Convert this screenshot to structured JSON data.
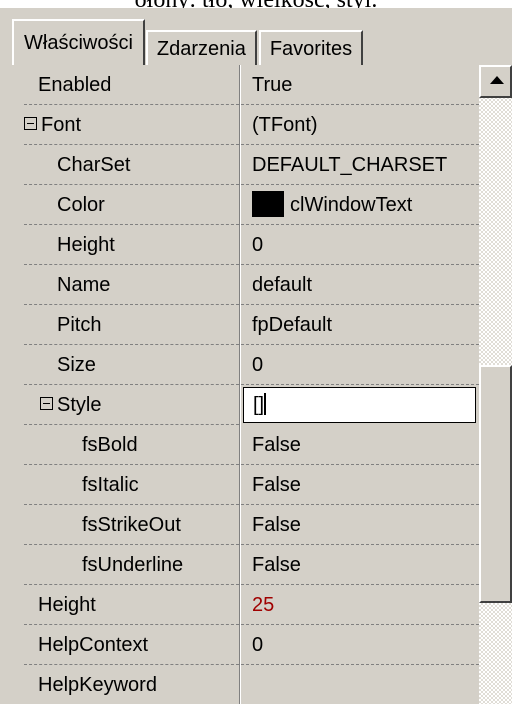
{
  "top_text": "ołony: tło, wielkość, styl.",
  "tabs": [
    {
      "label": "Właściwości"
    },
    {
      "label": "Zdarzenia"
    },
    {
      "label": "Favorites"
    }
  ],
  "properties": [
    {
      "name": "Enabled",
      "value": "True"
    },
    {
      "name": "Font",
      "value": "(TFont)"
    },
    {
      "name": "CharSet",
      "value": "DEFAULT_CHARSET"
    },
    {
      "name": "Color",
      "value": "clWindowText",
      "swatch_color": "#000000"
    },
    {
      "name": "Height",
      "value": "0"
    },
    {
      "name": "Name",
      "value": "default"
    },
    {
      "name": "Pitch",
      "value": "fpDefault"
    },
    {
      "name": "Size",
      "value": "0"
    },
    {
      "name": "Style",
      "value": "[]"
    },
    {
      "name": "fsBold",
      "value": "False"
    },
    {
      "name": "fsItalic",
      "value": "False"
    },
    {
      "name": "fsStrikeOut",
      "value": "False"
    },
    {
      "name": "fsUnderline",
      "value": "False"
    },
    {
      "name": "Height",
      "value": "25",
      "value_color": "#a00000"
    },
    {
      "name": "HelpContext",
      "value": "0"
    },
    {
      "name": "HelpKeyword",
      "value": ""
    }
  ],
  "icons": {
    "expander": "minus-box-icon",
    "scroll_up": "up-arrow-icon"
  }
}
